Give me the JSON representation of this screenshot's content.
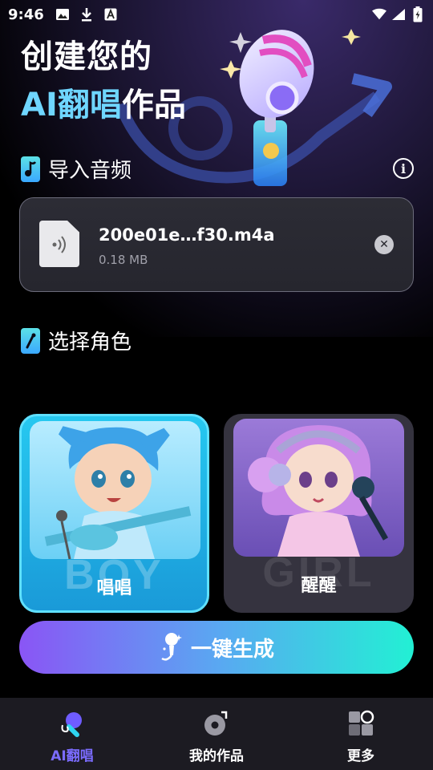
{
  "status_bar": {
    "time": "9:46",
    "left_icons": [
      "image-icon",
      "download-icon",
      "font-icon"
    ],
    "right_icons": [
      "wifi-icon",
      "signal-icon",
      "battery-icon"
    ]
  },
  "hero": {
    "line1": "创建您的",
    "line2_accent": "AI翻唱",
    "line2_rest": "作品"
  },
  "import_section": {
    "title": "导入音频",
    "info_icon": "info-icon"
  },
  "file": {
    "name": "200e01e…f30.m4a",
    "size": "0.18 MB"
  },
  "role_section": {
    "title": "选择角色"
  },
  "roles": [
    {
      "watermark": "BOY",
      "name": "唱唱",
      "selected": true
    },
    {
      "watermark": "GIRL",
      "name": "醒醒",
      "selected": false
    }
  ],
  "generate_button": {
    "label": "一键生成"
  },
  "bottom_nav": [
    {
      "label": "AI翻唱",
      "icon": "music-note-icon",
      "active": true
    },
    {
      "label": "我的作品",
      "icon": "record-disc-icon",
      "active": false
    },
    {
      "label": "更多",
      "icon": "grid-icon",
      "active": false
    }
  ],
  "colors": {
    "accent_blue": "#6fd6ff",
    "nav_active": "#7b6cff",
    "button_start": "#8a55f5",
    "button_end": "#22f0d4"
  }
}
